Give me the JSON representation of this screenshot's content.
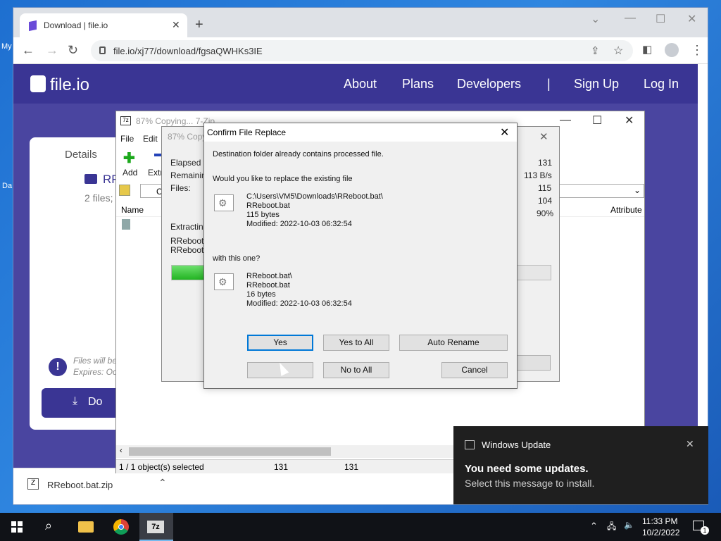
{
  "desktop": {
    "icon_labels": [
      "My",
      "Da"
    ]
  },
  "browser": {
    "tab_title": "Download | file.io",
    "url": "file.io/xj77/download/fgsaQWHKs3IE",
    "download_file": "RReboot.bat.zip"
  },
  "site": {
    "logo": "file.io",
    "nav": [
      "About",
      "Plans",
      "Developers",
      "|",
      "Sign Up",
      "Log In"
    ],
    "card_tab": "Details",
    "folder_name": "RR",
    "files_text": "2 files;",
    "notice_line1": "Files will be",
    "notice_line2": "Expires: Oc",
    "download_label": "Do"
  },
  "zip_main": {
    "title": "87% Copying... 7-Zip",
    "menu": [
      "File",
      "Edit"
    ],
    "tool_add": "Add",
    "tool_extract": "Extr",
    "path_letter": "C",
    "col_name": "Name",
    "col_attr": "Attribute",
    "status_selected": "1 / 1 object(s) selected",
    "status_a": "131",
    "status_b": "131"
  },
  "progress": {
    "title": "87% Copy",
    "elapsed": "Elapsed ti",
    "remaining": "Remaining",
    "files": "Files:",
    "extracting": "Extracting",
    "file1": "RReboot.t",
    "file2": "RReboot.t",
    "v1": "131",
    "v2": "113 B/s",
    "v3": "115",
    "v4": "104",
    "v5": "90%",
    "btn_partial": "l",
    "percent_done": 87
  },
  "dialog": {
    "title": "Confirm File Replace",
    "line1": "Destination folder already contains processed file.",
    "line2": "Would you like to replace the existing file",
    "existing": {
      "path": "C:\\Users\\VM5\\Downloads\\RReboot.bat\\",
      "name": "RReboot.bat",
      "size": "115 bytes",
      "modified": "Modified: 2022-10-03 06:32:54"
    },
    "with_text": "with this one?",
    "incoming": {
      "path": "RReboot.bat\\",
      "name": "RReboot.bat",
      "size": "16 bytes",
      "modified": "Modified: 2022-10-03 06:32:54"
    },
    "buttons": {
      "yes": "Yes",
      "yes_all": "Yes to All",
      "auto_rename": "Auto Rename",
      "no": "",
      "no_all": "No to All",
      "cancel": "Cancel"
    }
  },
  "toast": {
    "app": "Windows Update",
    "title": "You need some updates.",
    "body": "Select this message to install."
  },
  "taskbar": {
    "time": "11:33 PM",
    "date": "10/2/2022",
    "notif_count": "1"
  }
}
